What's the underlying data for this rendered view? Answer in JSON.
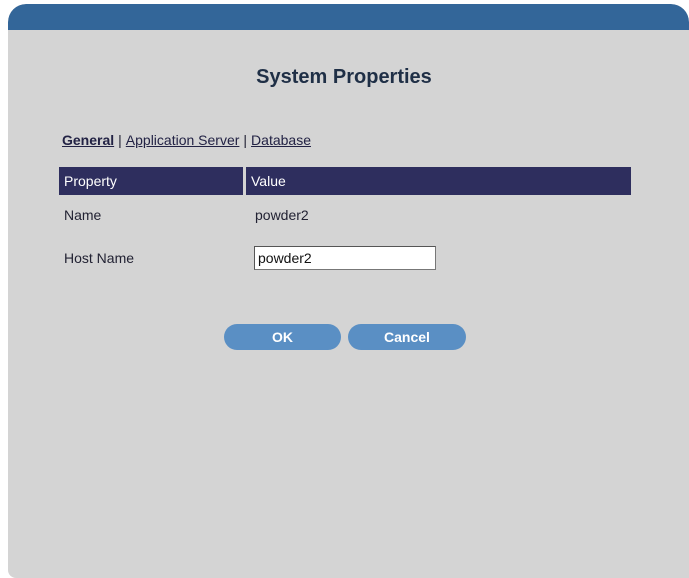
{
  "title": "System Properties",
  "tabs": {
    "general": "General",
    "app_server": "Application Server",
    "database": "Database",
    "separator": "|"
  },
  "table": {
    "headers": [
      "Property",
      "Value"
    ],
    "rows": [
      {
        "label": "Name",
        "value": "powder2"
      },
      {
        "label": "Host Name",
        "value": "powder2"
      }
    ]
  },
  "buttons": {
    "ok": "OK",
    "cancel": "Cancel"
  },
  "colors": {
    "topbar": "#336699",
    "panel": "#d4d4d4",
    "header": "#2e2e5e",
    "button": "#5a8fc4"
  }
}
